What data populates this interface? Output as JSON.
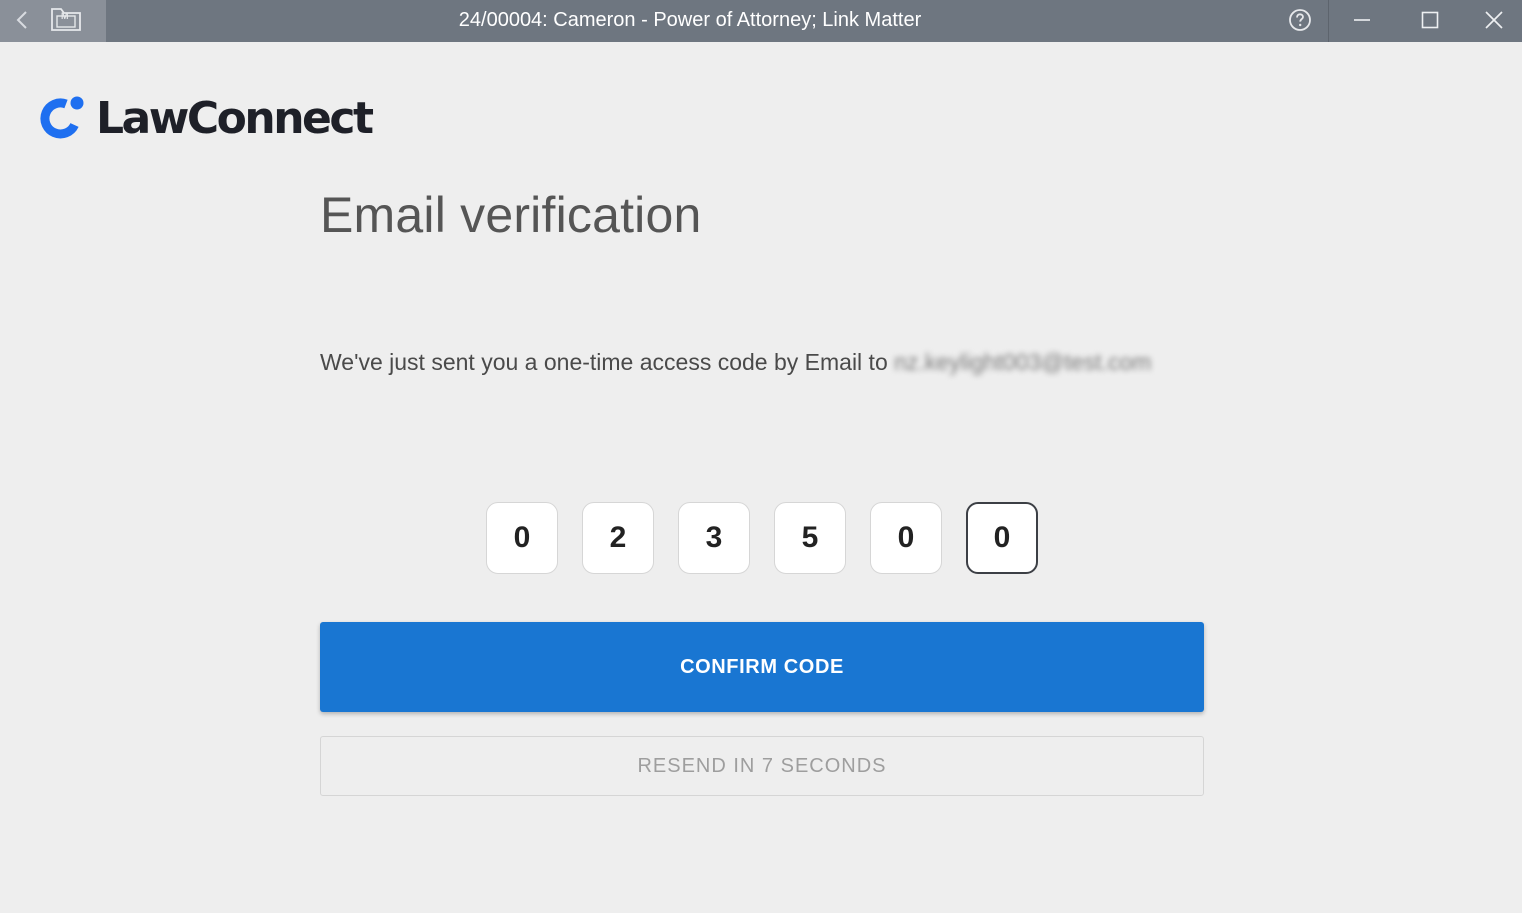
{
  "window": {
    "title": "24/00004: Cameron - Power of Attorney; Link Matter",
    "matter_icon_letter": "M",
    "icons": [
      "back-icon",
      "matter-folder-icon",
      "help-icon",
      "minimize-icon",
      "maximize-icon",
      "close-icon"
    ]
  },
  "brand": {
    "name": "LawConnect",
    "accent": "#1e6ff0"
  },
  "verification": {
    "title": "Email verification",
    "message": "We've just sent you a one-time access code by Email to",
    "email": "nz.keylight003@test.com",
    "code_digits": [
      "0",
      "2",
      "3",
      "5",
      "0",
      "0"
    ],
    "focused_index": 5
  },
  "actions": {
    "confirm_label": "CONFIRM CODE",
    "resend_label": "RESEND IN 7 SECONDS"
  },
  "colors": {
    "titlebar": "#6e7680",
    "background": "#eeeeee",
    "primary_button": "#1976d2"
  }
}
